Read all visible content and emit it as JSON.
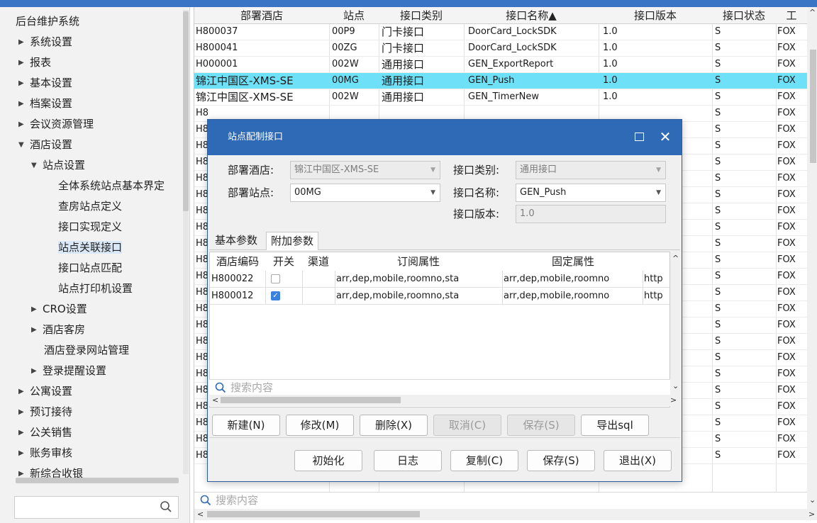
{
  "sidebar": {
    "items": [
      {
        "label": "后台维护系统",
        "arrow": ""
      },
      {
        "label": "系统设置",
        "arrow": "▶"
      },
      {
        "label": "报表",
        "arrow": "▶"
      },
      {
        "label": "基本设置",
        "arrow": "▶"
      },
      {
        "label": "档案设置",
        "arrow": "▶"
      },
      {
        "label": "会议资源管理",
        "arrow": "▶"
      },
      {
        "label": "酒店设置",
        "arrow": "▼"
      },
      {
        "label": "站点设置",
        "arrow": "▼"
      },
      {
        "label": "全体系统站点基本界定",
        "arrow": ""
      },
      {
        "label": "查房站点定义",
        "arrow": ""
      },
      {
        "label": "接口实现定义",
        "arrow": ""
      },
      {
        "label": "站点关联接口",
        "arrow": ""
      },
      {
        "label": "接口站点匹配",
        "arrow": ""
      },
      {
        "label": "站点打印机设置",
        "arrow": ""
      },
      {
        "label": "CRO设置",
        "arrow": "▶"
      },
      {
        "label": "酒店客房",
        "arrow": "▶"
      },
      {
        "label": "酒店登录网站管理",
        "arrow": ""
      },
      {
        "label": "登录提醒设置",
        "arrow": "▶"
      },
      {
        "label": "公寓设置",
        "arrow": "▶"
      },
      {
        "label": "预订接待",
        "arrow": "▶"
      },
      {
        "label": "公关销售",
        "arrow": "▶"
      },
      {
        "label": "账务审核",
        "arrow": "▶"
      },
      {
        "label": "新综合收银",
        "arrow": "▶"
      }
    ],
    "search_icon": "search-icon"
  },
  "table": {
    "headers": [
      "部署酒店",
      "站点",
      "接口类别",
      "接口名称▲",
      "接口版本",
      "接口状态",
      "工"
    ],
    "rows": [
      [
        "H800037",
        "00P9",
        "门卡接口",
        "DoorCard_LockSDK",
        "1.0",
        "S",
        "FOX"
      ],
      [
        "H800041",
        "00ZG",
        "门卡接口",
        "DoorCard_LockSDK",
        "1.0",
        "S",
        "FOX"
      ],
      [
        "H000001",
        "002W",
        "通用接口",
        "GEN_ExportReport",
        "1.0",
        "S",
        "FOX"
      ],
      [
        "锦江中国区-XMS-SE",
        "00MG",
        "通用接口",
        "GEN_Push",
        "1.0",
        "S",
        "FOX"
      ],
      [
        "锦江中国区-XMS-SE",
        "002W",
        "通用接口",
        "GEN_TimerNew",
        "1.0",
        "S",
        "FOX"
      ]
    ],
    "partial_rows": [
      "H8",
      "H8",
      "H8",
      "H8",
      "H8",
      "H8",
      "H8",
      "H8",
      "H8",
      "H8",
      "H8",
      "H8",
      "H8",
      "H8",
      "H8",
      "H8",
      "H8",
      "H8",
      "H8",
      "H8",
      "H8",
      "H8"
    ],
    "status_col": [
      "S",
      "S",
      "S",
      "S",
      "S",
      "S",
      "S",
      "S",
      "S",
      "S",
      "S",
      "S",
      "S",
      "S",
      "S",
      "S",
      "S",
      "S",
      "S",
      "S",
      "S",
      "S"
    ],
    "fox_col": [
      "FOX",
      "FOX",
      "FOX",
      "FOX",
      "FOX",
      "FOX",
      "FOX",
      "FOX",
      "FOX",
      "FOX",
      "FOX",
      "FOX",
      "FOX",
      "FOX",
      "FOX",
      "FOX",
      "FOX",
      "FOX",
      "FOX",
      "FOX",
      "FOX",
      "FOX"
    ],
    "highlight_color": "#6ee0f7",
    "search_placeholder": "搜索内容"
  },
  "dialog": {
    "title": "站点配制接口",
    "hotel_label": "部署酒店:",
    "hotel_value": "锦江中国区-XMS-SE",
    "site_label": "部署站点:",
    "site_value": "00MG",
    "category_label": "接口类别:",
    "category_value": "通用接口",
    "name_label": "接口名称:",
    "name_value": "GEN_Push",
    "version_label": "接口版本:",
    "version_value": "1.0",
    "tabs": [
      "基本参数",
      "附加参数"
    ],
    "grid": {
      "headers": [
        "酒店编码",
        "开关",
        "渠道",
        "订阅属性",
        "固定属性"
      ],
      "rows": [
        {
          "code": "H800022",
          "checked": false,
          "channel": "",
          "sub": "arr,dep,mobile,roomno,sta",
          "fixed": "arr,dep,mobile,roomno",
          "extra": "http"
        },
        {
          "code": "H800012",
          "checked": true,
          "channel": "",
          "sub": "arr,dep,mobile,roomno,sta",
          "fixed": "arr,dep,mobile,roomno",
          "extra": "http"
        }
      ],
      "search_placeholder": "搜索内容"
    },
    "row_buttons": [
      "新建(N)",
      "修改(M)",
      "删除(X)",
      "取消(C)",
      "保存(S)",
      "导出sql"
    ],
    "bottom_buttons": [
      "初始化",
      "日志",
      "复制(C)",
      "保存(S)",
      "退出(X)"
    ],
    "titlebar_color": "#2f6ab7"
  }
}
